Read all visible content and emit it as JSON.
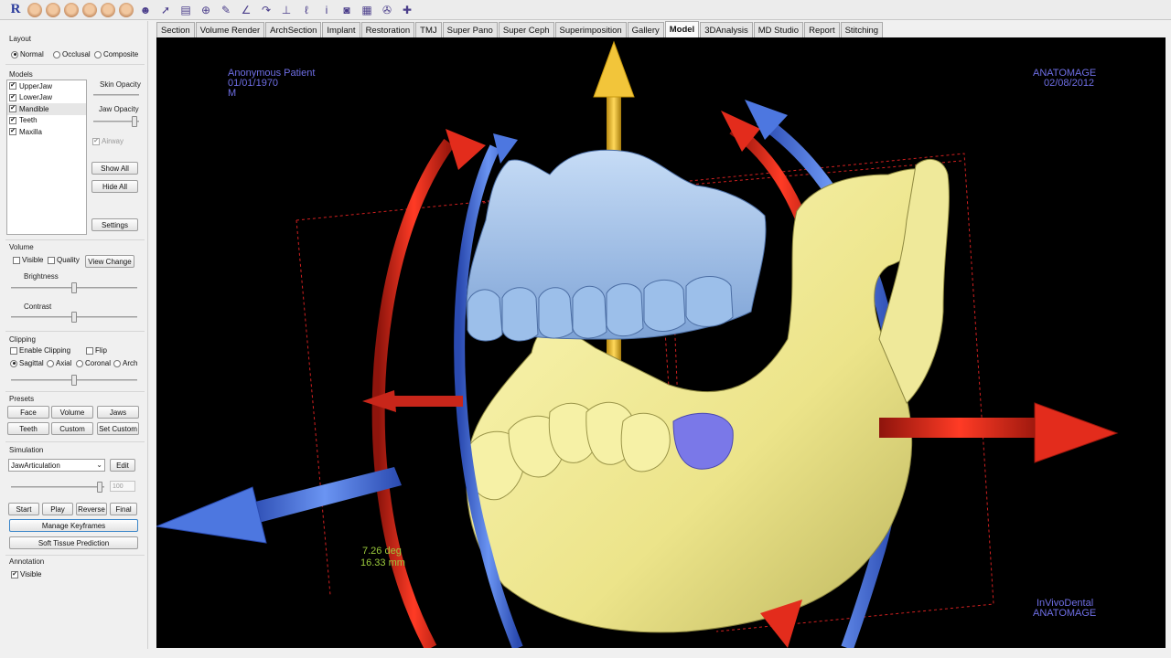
{
  "toolbar": {
    "logo": "R",
    "tools": [
      {
        "icon": "face-icon-1",
        "glyph": ""
      },
      {
        "icon": "face-icon-2",
        "glyph": ""
      },
      {
        "icon": "face-icon-3",
        "glyph": ""
      },
      {
        "icon": "face-icon-4",
        "glyph": ""
      },
      {
        "icon": "face-icon-5",
        "glyph": ""
      },
      {
        "icon": "face-icon-6",
        "glyph": ""
      },
      {
        "icon": "head-profile-icon",
        "glyph": "☻"
      },
      {
        "icon": "pointer-icon",
        "glyph": "➚"
      },
      {
        "icon": "film-icon",
        "glyph": "▤"
      },
      {
        "icon": "crosshair-icon",
        "glyph": "⊕"
      },
      {
        "icon": "pencil-icon",
        "glyph": "✎"
      },
      {
        "icon": "angle-measure-icon",
        "glyph": "∠"
      },
      {
        "icon": "curve-icon",
        "glyph": "↷"
      },
      {
        "icon": "ruler-icon",
        "glyph": "⊥"
      },
      {
        "icon": "nerve-icon",
        "glyph": "ℓ"
      },
      {
        "icon": "info-icon",
        "glyph": "i"
      },
      {
        "icon": "camera-icon",
        "glyph": "◙"
      },
      {
        "icon": "grid-icon",
        "glyph": "▦"
      },
      {
        "icon": "wrench-icon",
        "glyph": "✇"
      },
      {
        "icon": "add-point-icon",
        "glyph": "✚"
      }
    ]
  },
  "tabs": [
    "Section",
    "Volume Render",
    "ArchSection",
    "Implant",
    "Restoration",
    "TMJ",
    "Super Pano",
    "Super Ceph",
    "Superimposition",
    "Gallery",
    "Model",
    "3DAnalysis",
    "MD Studio",
    "Report",
    "Stitching"
  ],
  "active_tab": "Model",
  "panel": {
    "layout": {
      "title": "Layout",
      "options": [
        "Normal",
        "Occlusal",
        "Composite"
      ],
      "selected": "Normal"
    },
    "models": {
      "title": "Models",
      "items": [
        {
          "label": "UpperJaw",
          "checked": "✔"
        },
        {
          "label": "LowerJaw",
          "checked": "✔"
        },
        {
          "label": "Mandible",
          "checked": "✔"
        },
        {
          "label": "Teeth",
          "checked": "✔"
        },
        {
          "label": "Maxilla",
          "checked": "✔"
        }
      ],
      "selected_item": "Mandible",
      "skin_opacity": "Skin Opacity",
      "jaw_opacity": "Jaw Opacity",
      "airway": "Airway",
      "airway_check": "✔",
      "show_all": "Show All",
      "hide_all": "Hide All",
      "settings": "Settings"
    },
    "volume": {
      "title": "Volume",
      "visible": "Visible",
      "quality": "Quality",
      "view_change": "View Change",
      "brightness": "Brightness",
      "contrast": "Contrast"
    },
    "clipping": {
      "title": "Clipping",
      "enable": "Enable Clipping",
      "flip": "Flip",
      "options": [
        "Sagittal",
        "Axial",
        "Coronal",
        "Arch"
      ],
      "selected": "Sagittal"
    },
    "presets": {
      "title": "Presets",
      "buttons": [
        "Face",
        "Volume",
        "Jaws",
        "Teeth",
        "Custom",
        "Set Custom"
      ]
    },
    "simulation": {
      "title": "Simulation",
      "select_value": "JawArticulation",
      "edit": "Edit",
      "value_box": "100",
      "start": "Start",
      "play": "Play",
      "reverse": "Reverse",
      "final": "Final",
      "manage_keyframes": "Manage Keyframes",
      "soft_tissue": "Soft Tissue Prediction"
    },
    "annotation": {
      "title": "Annotation",
      "visible": "Visible",
      "visible_check": "✔"
    }
  },
  "viewport": {
    "patient_name": "Anonymous Patient",
    "patient_dob": "01/01/1970",
    "patient_sex": "M",
    "brand": "ANATOMAGE",
    "scan_date": "02/08/2012",
    "measure_angle": "7.26 deg",
    "measure_dist": "16.33 mm",
    "footer_line1": "InVivoDental",
    "footer_line2": "ANATOMAGE",
    "colors": {
      "background": "#000000",
      "maxilla": "#a9c8ef",
      "mandible": "#f2ee9c",
      "red_arrow": "#e32c1c",
      "blue_arrow": "#4d77e0",
      "yellow_arrow": "#f2c53a",
      "overlay_text": "#6f6fe6",
      "measure_text": "#9ccb3c"
    }
  }
}
